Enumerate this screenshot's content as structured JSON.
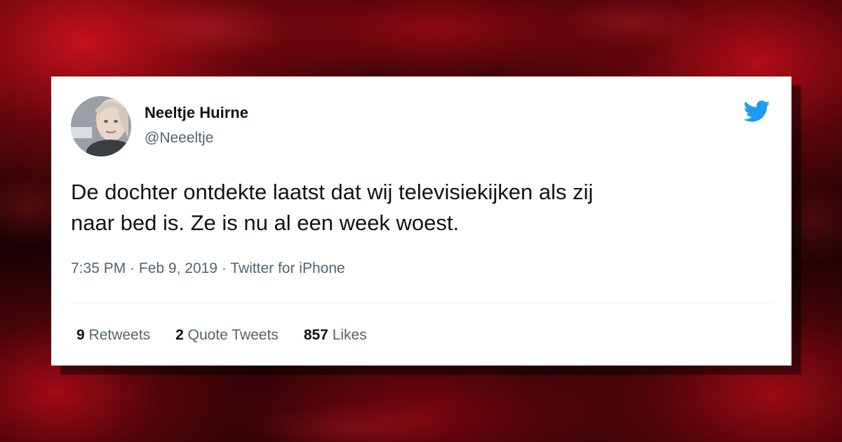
{
  "tweet": {
    "author_name": "Neeltje Huirne",
    "author_handle": "@Neeeltje",
    "text_line1": "De dochter ontdekte laatst dat wij televisiekijken als zij",
    "text_line2": "naar bed is. Ze is nu al een week woest.",
    "time": "7:35 PM",
    "sep1": " · ",
    "date": "Feb 9, 2019",
    "sep2": " · ",
    "source": "Twitter for iPhone",
    "retweets_count": "9",
    "retweets_label": "Retweets",
    "quote_count": "2",
    "quote_label": "Quote Tweets",
    "likes_count": "857",
    "likes_label": "Likes"
  },
  "icons": {
    "brand": "twitter-bird-icon",
    "avatar": "avatar"
  },
  "colors": {
    "twitter_blue": "#1d9bf0",
    "text_primary": "#0f1419",
    "text_secondary": "#536471",
    "background_red": "#c4101c"
  }
}
